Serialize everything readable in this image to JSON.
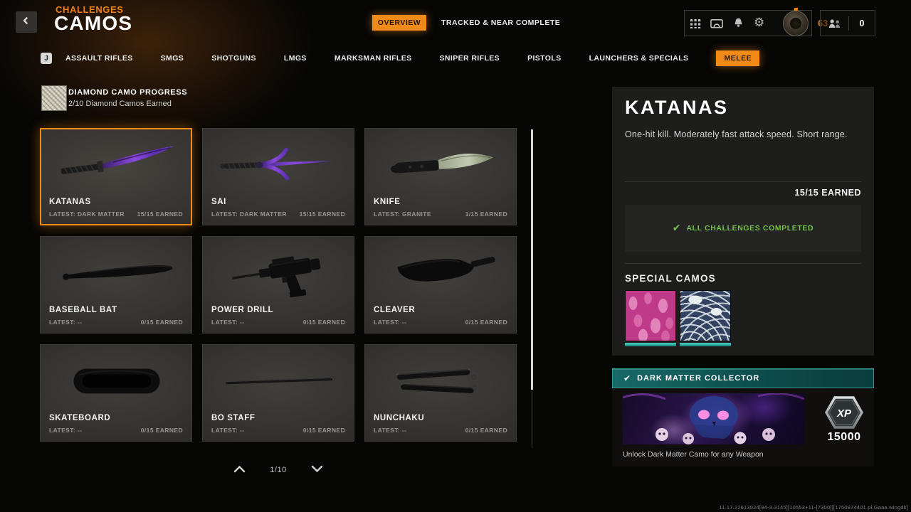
{
  "colors": {
    "accent": "#f28a18",
    "success_green": "#76c14a",
    "collector_teal": "#2d9a92"
  },
  "icons": {
    "gear_glyph": "⚙",
    "check_glyph": "✔"
  },
  "header": {
    "breadcrumb": "CHALLENGES",
    "title": "CAMOS",
    "view_tabs": [
      {
        "label": "OVERVIEW"
      },
      {
        "label": "TRACKED & NEAR COMPLETE"
      }
    ],
    "level": "63",
    "party_count": "0"
  },
  "weapon_tabs": {
    "key_hint": "J",
    "items": [
      {
        "label": "ASSAULT RIFLES"
      },
      {
        "label": "SMGS"
      },
      {
        "label": "SHOTGUNS"
      },
      {
        "label": "LMGS"
      },
      {
        "label": "MARKSMAN RIFLES"
      },
      {
        "label": "SNIPER RIFLES"
      },
      {
        "label": "PISTOLS"
      },
      {
        "label": "LAUNCHERS & SPECIALS"
      },
      {
        "label": "MELEE"
      }
    ]
  },
  "diamond_progress": {
    "title": "DIAMOND CAMO PROGRESS",
    "subtitle": "2/10 Diamond Camos Earned"
  },
  "grid": {
    "cards": [
      {
        "name": "KATANAS",
        "latest": "LATEST: DARK MATTER",
        "earned": "15/15 EARNED"
      },
      {
        "name": "SAI",
        "latest": "LATEST: DARK MATTER",
        "earned": "15/15 EARNED"
      },
      {
        "name": "KNIFE",
        "latest": "LATEST: GRANITE",
        "earned": "1/15 EARNED"
      },
      {
        "name": "BASEBALL BAT",
        "latest": "LATEST: --",
        "earned": "0/15 EARNED"
      },
      {
        "name": "POWER DRILL",
        "latest": "LATEST: --",
        "earned": "0/15 EARNED"
      },
      {
        "name": "CLEAVER",
        "latest": "LATEST: --",
        "earned": "0/15 EARNED"
      },
      {
        "name": "SKATEBOARD",
        "latest": "LATEST: --",
        "earned": "0/15 EARNED"
      },
      {
        "name": "BO STAFF",
        "latest": "LATEST: --",
        "earned": "0/15 EARNED"
      },
      {
        "name": "NUNCHAKU",
        "latest": "LATEST: --",
        "earned": "0/15 EARNED"
      }
    ]
  },
  "pagination": {
    "page": "1/10"
  },
  "detail": {
    "title": "KATANAS",
    "description": "One-hit kill. Moderately fast attack speed. Short range.",
    "earned": "15/15 EARNED",
    "completed_label": "ALL CHALLENGES COMPLETED",
    "special_camos_title": "SPECIAL CAMOS"
  },
  "collector": {
    "title": "DARK MATTER COLLECTOR",
    "xp_label": "XP",
    "xp_value": "15000",
    "subtitle": "Unlock Dark Matter Camo for any Weapon"
  },
  "footer": {
    "version": "11.17.22613024[94-3.3145][10553+11-[7300]][1750874401.pl.Gaaa.wingdk]"
  }
}
